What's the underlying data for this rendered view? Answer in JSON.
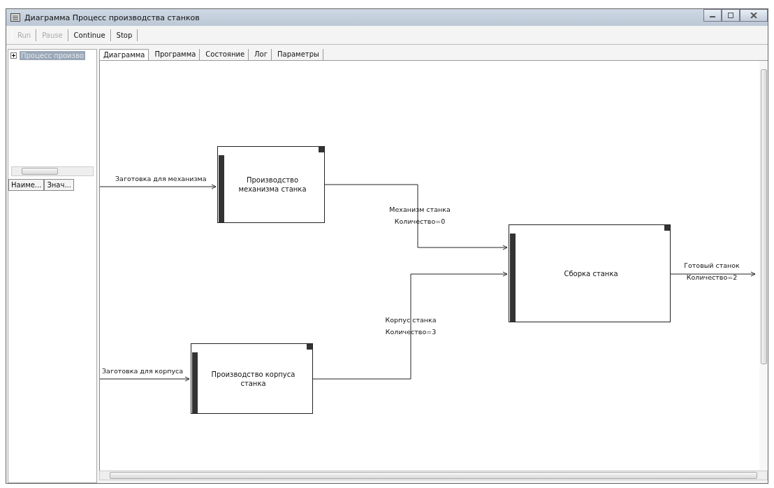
{
  "window": {
    "title": "Диаграмма Процесс производства станков"
  },
  "toolbar": [
    {
      "label": "Run",
      "disabled": true
    },
    {
      "label": "Pause",
      "disabled": true
    },
    {
      "label": "Continue",
      "disabled": false
    },
    {
      "label": "Stop",
      "disabled": false
    }
  ],
  "tree": [
    {
      "label": "Процесс произво",
      "selected": true,
      "expanded": false
    }
  ],
  "properties": {
    "columns": [
      "Наиме...",
      "Знач..."
    ]
  },
  "tabs": [
    {
      "label": "Диаграмма",
      "selected": true
    },
    {
      "label": "Программа",
      "selected": false
    },
    {
      "label": "Состояние",
      "selected": false
    },
    {
      "label": "Лог",
      "selected": false
    },
    {
      "label": "Параметры",
      "selected": false
    }
  ],
  "diagram": {
    "blocks": [
      {
        "label": "Производство механизма станка"
      },
      {
        "label": "Сборка станка"
      },
      {
        "label": "Производство корпуса станка"
      }
    ],
    "flows": [
      {
        "label": "Заготовка для механизма"
      },
      {
        "label": "Механизм станка",
        "quantity": "Количество=0"
      },
      {
        "label": "Заготовка для корпуса"
      },
      {
        "label": "Корпус станка",
        "quantity": "Количество=3"
      },
      {
        "label": "Готовый станок",
        "quantity": "Количество=2"
      }
    ]
  }
}
